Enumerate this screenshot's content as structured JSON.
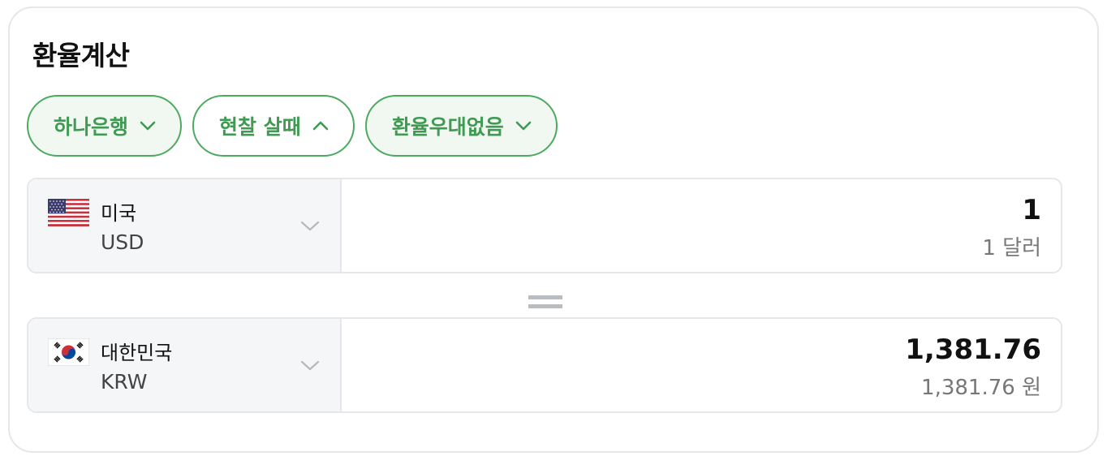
{
  "title": "환율계산",
  "chips": [
    {
      "label": "하나은행",
      "chevron": "down"
    },
    {
      "label": "현찰 살때",
      "chevron": "up"
    },
    {
      "label": "환율우대없음",
      "chevron": "down"
    }
  ],
  "from": {
    "flag_icon": "us-flag-icon",
    "country": "미국",
    "code": "USD",
    "amount": "1",
    "amount_text": "1 달러"
  },
  "to": {
    "flag_icon": "kr-flag-icon",
    "country": "대한민국",
    "code": "KRW",
    "amount": "1,381.76",
    "amount_text": "1,381.76 원"
  },
  "colors": {
    "accent": "#4caa5f",
    "accent_text": "#3f9a52",
    "selector_bg": "#f5f6f8",
    "border": "#e5e7eb"
  }
}
